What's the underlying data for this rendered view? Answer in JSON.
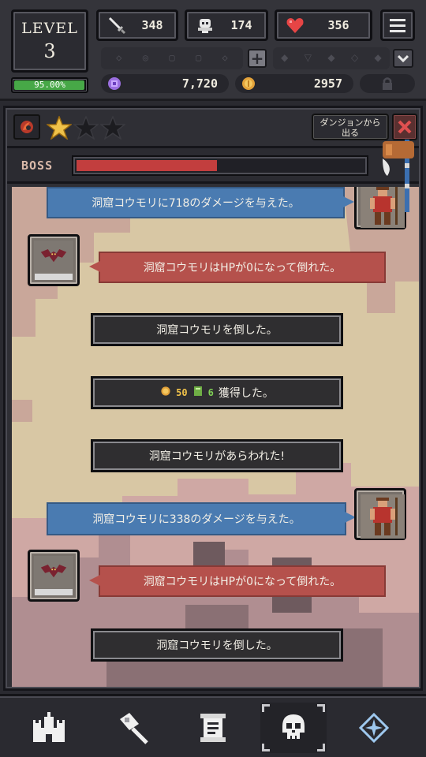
{
  "hud": {
    "level_label": "LEVEL",
    "level_value": "3",
    "xp_percent_text": "95.00%",
    "xp_fraction": 0.95,
    "attack": "348",
    "defense": "174",
    "hp": "356",
    "gems": "7,720",
    "gold": "2957"
  },
  "dungeon": {
    "stars_filled": 1,
    "stars_total": 3,
    "exit_label_line1": "ダンジョンから",
    "exit_label_line2": "出る",
    "boss_label": "BOSS",
    "boss_progress": 0.49
  },
  "log": [
    {
      "kind": "blue",
      "text": "洞窟コウモリに718のダメージを与えた。"
    },
    {
      "kind": "red",
      "text": "洞窟コウモリはHPが0になって倒れた。"
    },
    {
      "kind": "dark",
      "text": "洞窟コウモリを倒した。"
    },
    {
      "kind": "loot",
      "gold": "50",
      "xp": "6",
      "suffix": "獲得した。"
    },
    {
      "kind": "dark",
      "text": "洞窟コウモリがあらわれた!"
    },
    {
      "kind": "blue",
      "text": "洞窟コウモリに338のダメージを与えた。"
    },
    {
      "kind": "red",
      "text": "洞窟コウモリはHPが0になって倒れた。"
    },
    {
      "kind": "dark",
      "text": "洞窟コウモリを倒した。"
    }
  ],
  "colors": {
    "xp_green": "#47a847",
    "boss_red": "#c23e3e",
    "blue_msg": "#4a7bb1",
    "red_msg": "#b5514c",
    "star_gold": "#f0c24a"
  },
  "icons": {
    "attack": "sword-icon",
    "defense": "skull-shield-icon",
    "hp": "heart-icon",
    "menu": "hamburger-menu-icon",
    "gem": "gem-icon",
    "gold": "gold-coin-icon",
    "lock": "lock-icon",
    "nav": [
      "castle-icon",
      "hammer-icon",
      "scroll-icon",
      "skull-icon",
      "compass-icon"
    ]
  }
}
